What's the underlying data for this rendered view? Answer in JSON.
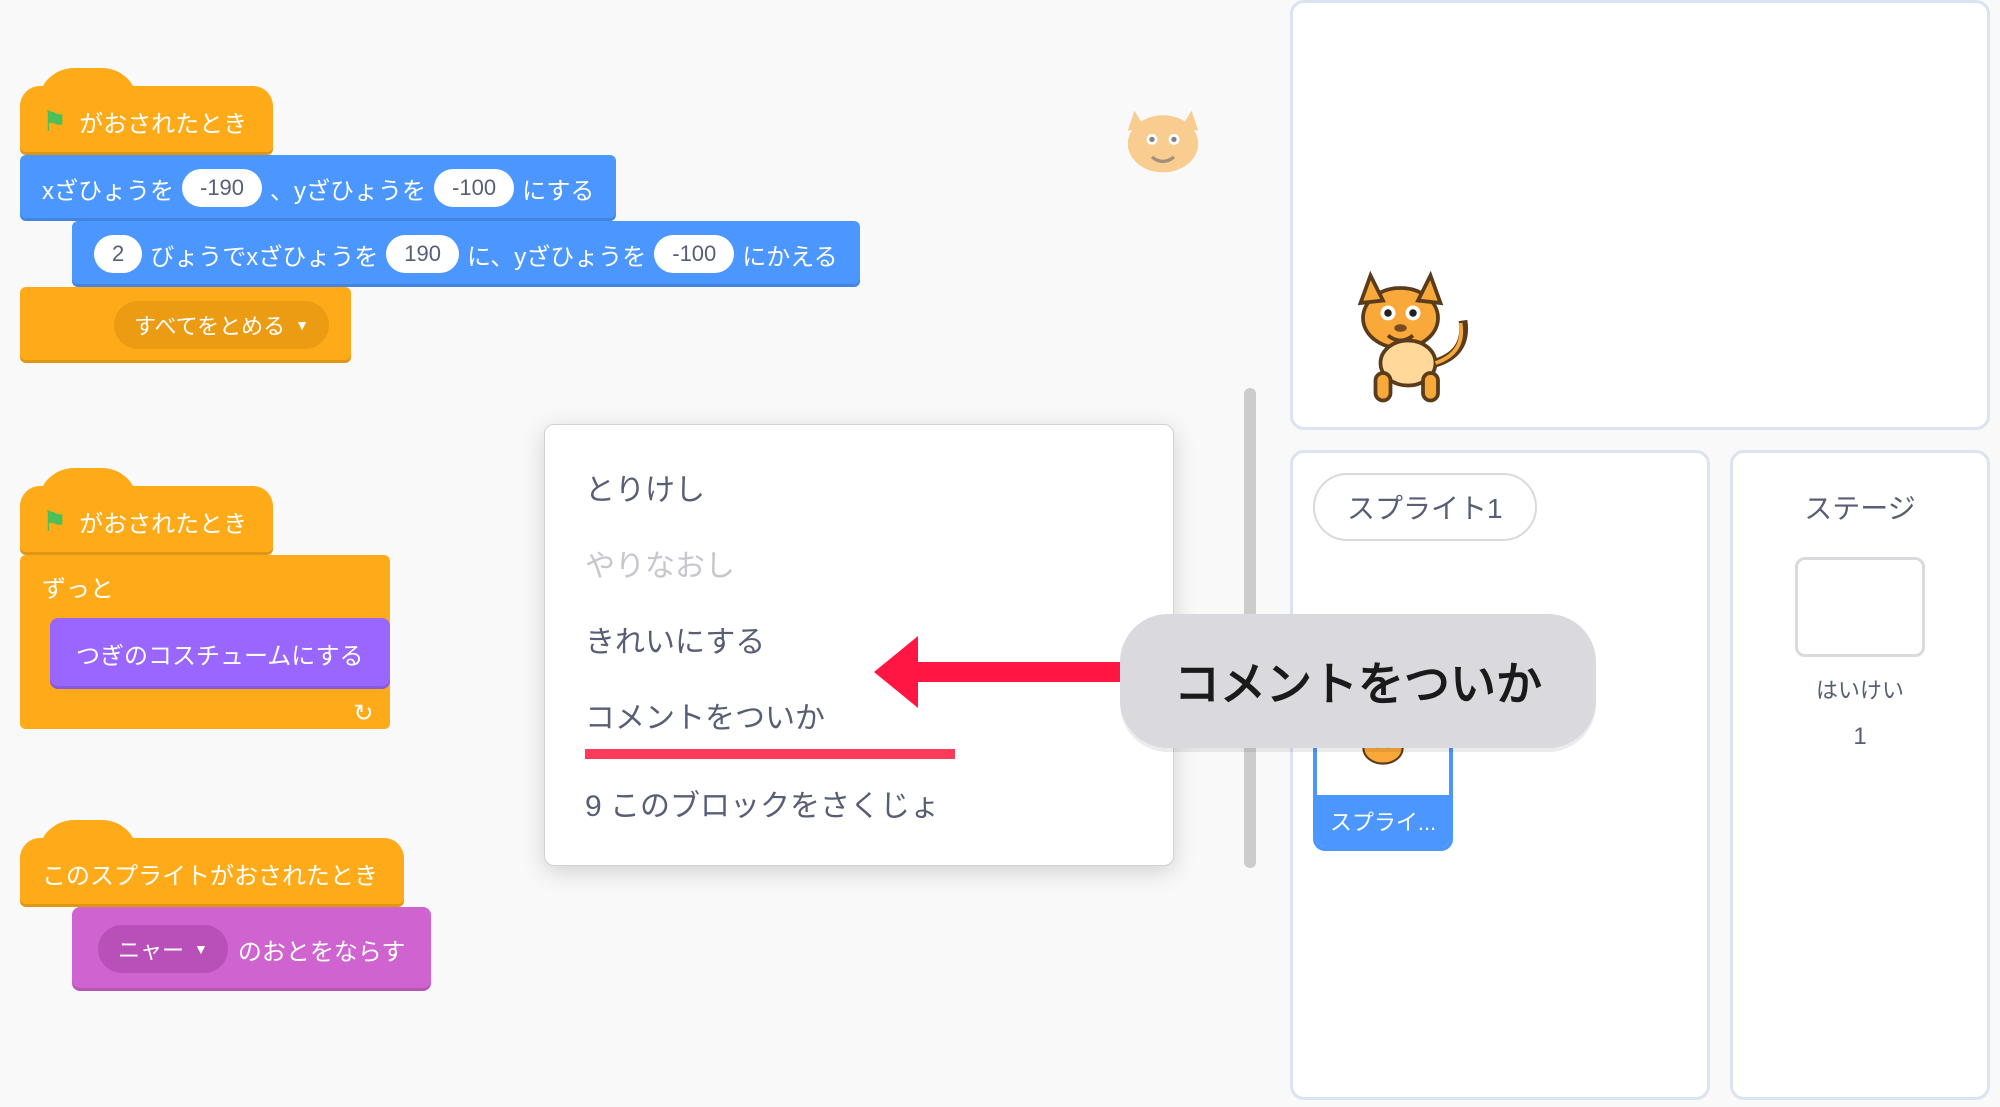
{
  "stack1": {
    "hat": "がおされたとき",
    "goto": {
      "p1": "xざひょうを",
      "x": "-190",
      "p2": "、yざひょうを",
      "y": "-100",
      "p3": "にする"
    },
    "glide": {
      "t": "2",
      "p1": "びょうでxざひょうを",
      "x": "190",
      "p2": "に、yざひょうを",
      "y": "-100",
      "p3": "にかえる"
    },
    "stop": "すべてをとめる"
  },
  "stack2": {
    "hat": "がおされたとき",
    "forever": "ずっと",
    "next_costume": "つぎのコスチュームにする"
  },
  "stack3": {
    "hat": "このスプライトがおされたとき",
    "play": {
      "sound": "ニャー",
      "suffix": "のおとをならす"
    }
  },
  "context_menu": {
    "undo": "とりけし",
    "redo": "やりなおし",
    "cleanup": "きれいにする",
    "add_comment": "コメントをついか",
    "delete_blocks": "9 このブロックをさくじょ"
  },
  "callout": "コメントをついか",
  "sprite_panel": {
    "name": "スプライト1",
    "thumb_label": "スプライ..."
  },
  "stage_panel": {
    "title": "ステージ",
    "backdrop_label": "はいけい",
    "backdrop_count": "1"
  }
}
